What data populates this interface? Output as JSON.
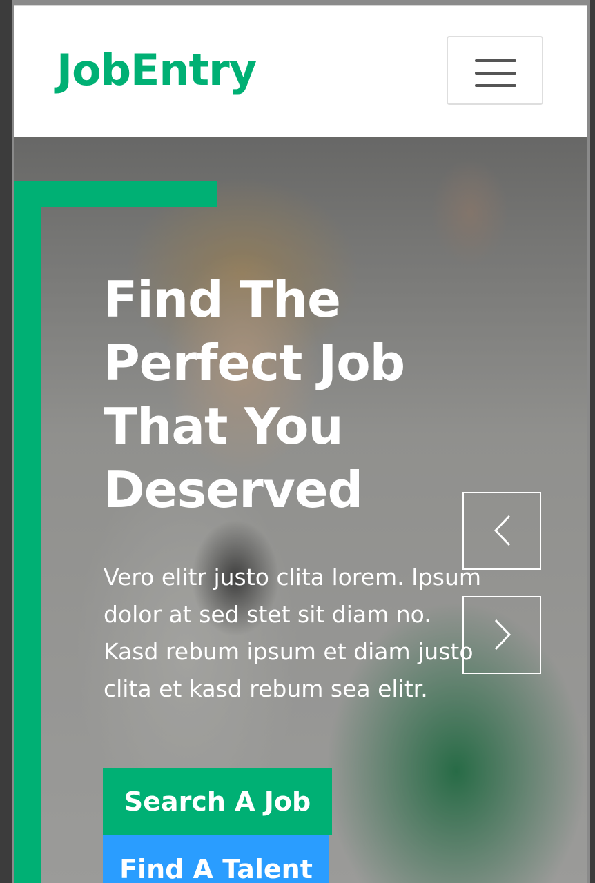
{
  "navbar": {
    "brand": "JobEntry",
    "toggler_icon": "hamburger-menu-icon"
  },
  "hero": {
    "title": "Find The Perfect Job That You Deserved",
    "description": "Vero elitr justo clita lorem. Ipsum dolor at sed stet sit diam no. Kasd rebum ipsum et diam justo clita et kasd rebum sea elitr.",
    "primary_button": "Search A Job",
    "secondary_button": "Find A Talent",
    "prev_icon": "chevron-left-icon",
    "next_icon": "chevron-right-icon"
  },
  "colors": {
    "brand_green": "#00b074",
    "talent_blue": "#2a9dff",
    "white": "#ffffff"
  }
}
